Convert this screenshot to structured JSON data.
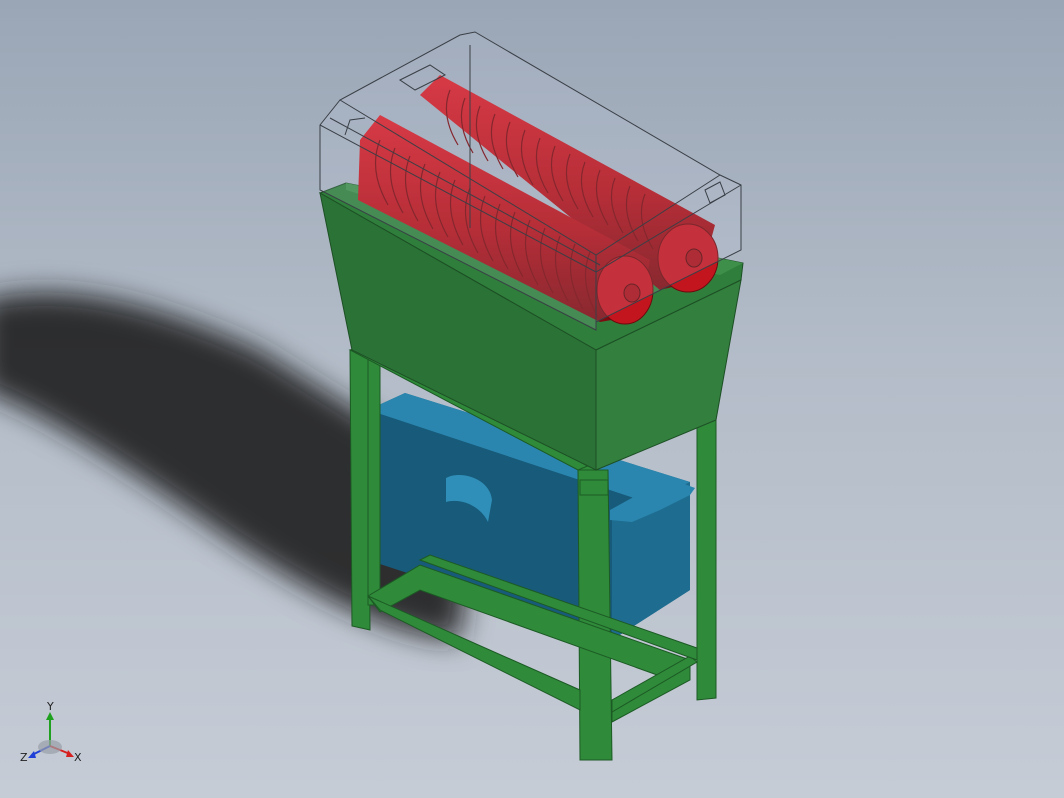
{
  "triad": {
    "x_label": "X",
    "y_label": "Y",
    "z_label": "Z",
    "x_color": "#d62020",
    "y_color": "#1fa11f",
    "z_color": "#1f3fd6"
  },
  "colors": {
    "background_top": "#9aa6b6",
    "background_bottom": "#c6ccd6",
    "frame_green": "#2f8a3a",
    "hopper_green": "#2f7a3a",
    "roller_red": "#c0151d",
    "tray_blue": "#1b6f92",
    "cover_outline": "#3a3f46"
  },
  "model": {
    "parts": [
      "transparent-cover",
      "shredding-rollers",
      "hopper",
      "support-frame",
      "collection-tray",
      "floor-shadow"
    ]
  }
}
